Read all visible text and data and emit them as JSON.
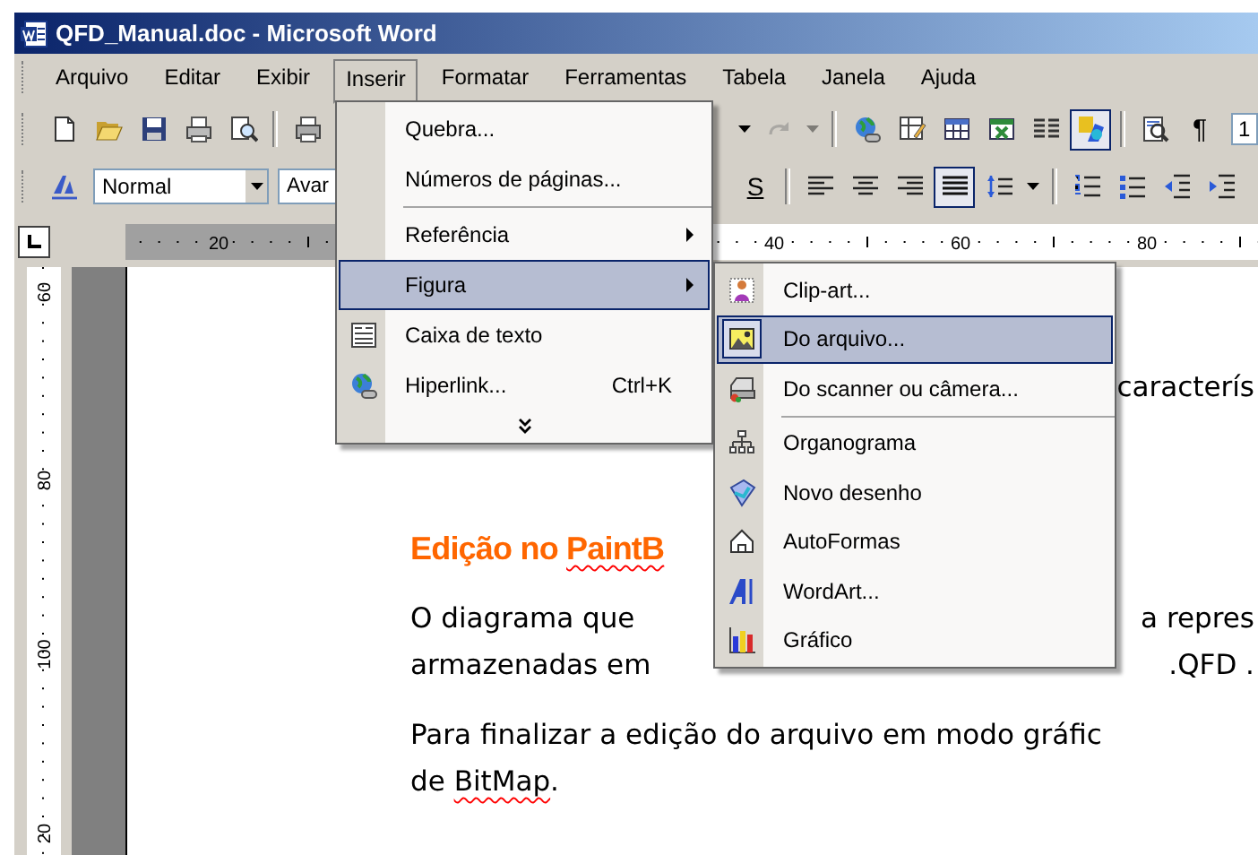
{
  "window": {
    "title": "QFD_Manual.doc - Microsoft Word"
  },
  "menu_bar": [
    {
      "label": "Arquivo",
      "selected": false
    },
    {
      "label": "Editar",
      "selected": false
    },
    {
      "label": "Exibir",
      "selected": false
    },
    {
      "label": "Inserir",
      "selected": true
    },
    {
      "label": "Formatar",
      "selected": false
    },
    {
      "label": "Ferramentas",
      "selected": false
    },
    {
      "label": "Tabela",
      "selected": false
    },
    {
      "label": "Janela",
      "selected": false
    },
    {
      "label": "Ajuda",
      "selected": false
    }
  ],
  "toolbars": {
    "standard": {
      "left": [
        {
          "kind": "button",
          "pressed": false,
          "disabled": false
        },
        {
          "kind": "button",
          "pressed": false,
          "disabled": false
        },
        {
          "kind": "button",
          "pressed": false,
          "disabled": false
        },
        {
          "kind": "button",
          "pressed": false,
          "disabled": false
        },
        {
          "kind": "button",
          "pressed": false,
          "disabled": false
        },
        {
          "kind": "separator"
        },
        {
          "kind": "button",
          "pressed": false,
          "disabled": false
        }
      ],
      "right": [
        {
          "kind": "arrow",
          "disabled": false
        },
        {
          "kind": "button",
          "pressed": false,
          "disabled": true
        },
        {
          "kind": "arrow",
          "disabled": true
        },
        {
          "kind": "separator"
        },
        {
          "kind": "button",
          "pressed": false,
          "disabled": false
        },
        {
          "kind": "button",
          "pressed": false,
          "disabled": false
        },
        {
          "kind": "button",
          "pressed": false,
          "disabled": false
        },
        {
          "kind": "button",
          "pressed": false,
          "disabled": false
        },
        {
          "kind": "button",
          "pressed": false,
          "disabled": false
        },
        {
          "kind": "button",
          "pressed": true,
          "disabled": false
        },
        {
          "kind": "separator"
        },
        {
          "kind": "button",
          "pressed": false,
          "disabled": false
        },
        {
          "kind": "text_button",
          "label": "¶",
          "pressed": false,
          "disabled": false
        },
        {
          "kind": "field",
          "value": "1"
        }
      ]
    },
    "formatting": {
      "left": [
        {
          "kind": "button",
          "pressed": false,
          "disabled": false
        },
        {
          "kind": "combo",
          "value": "Normal"
        },
        {
          "kind": "combo",
          "value": "Avar"
        }
      ],
      "right": [
        {
          "kind": "text_button",
          "label": "S",
          "pressed": false,
          "disabled": false
        },
        {
          "kind": "separator"
        },
        {
          "kind": "button",
          "pressed": false,
          "disabled": false
        },
        {
          "kind": "button",
          "pressed": false,
          "disabled": false
        },
        {
          "kind": "button",
          "pressed": false,
          "disabled": false
        },
        {
          "kind": "button",
          "pressed": true,
          "disabled": false
        },
        {
          "kind": "button",
          "pressed": false,
          "disabled": false
        },
        {
          "kind": "arrow",
          "disabled": false
        },
        {
          "kind": "separator"
        },
        {
          "kind": "button",
          "pressed": false,
          "disabled": false
        },
        {
          "kind": "button",
          "pressed": false,
          "disabled": false
        },
        {
          "kind": "button",
          "pressed": false,
          "disabled": false
        },
        {
          "kind": "button",
          "pressed": false,
          "disabled": false
        }
      ]
    }
  },
  "ruler": {
    "labels": [
      "20",
      "40",
      "60",
      "80"
    ]
  },
  "vertical_ruler": {
    "labels": [
      "60",
      "80",
      "100",
      "20"
    ]
  },
  "document": {
    "blocks": [
      {
        "kind": "paragraph",
        "lines": [
          {
            "right": [
              {
                "text": "caracterís",
                "misspelled": false
              }
            ]
          }
        ]
      },
      {
        "kind": "heading",
        "lines": [
          {
            "left": [
              {
                "text": "Edição no ",
                "misspelled": false
              },
              {
                "text": "PaintB",
                "misspelled": true
              }
            ]
          }
        ]
      },
      {
        "kind": "paragraph",
        "lines": [
          {
            "left": [
              {
                "text": "O diagrama que",
                "misspelled": false
              }
            ],
            "right": [
              {
                "text": "a repres",
                "misspelled": false
              }
            ]
          },
          {
            "left": [
              {
                "text": "armazenadas em",
                "misspelled": false
              }
            ],
            "right": [
              {
                "text": ".QFD .",
                "misspelled": false
              }
            ]
          }
        ]
      },
      {
        "kind": "paragraph",
        "lines": [
          {
            "left": [
              {
                "text": "Para finalizar a edição do arquivo em modo gráfic",
                "misspelled": false
              }
            ]
          },
          {
            "left": [
              {
                "text": "de ",
                "misspelled": false
              },
              {
                "text": "BitMap",
                "misspelled": true
              },
              {
                "text": ".",
                "misspelled": false
              }
            ]
          }
        ]
      }
    ]
  },
  "open_menu": {
    "items": [
      {
        "kind": "item",
        "label": "Quebra...",
        "selected": false,
        "arrow": false
      },
      {
        "kind": "item",
        "label": "Números de páginas...",
        "selected": false,
        "arrow": false
      },
      {
        "kind": "separator"
      },
      {
        "kind": "item",
        "label": "Referência",
        "selected": false,
        "arrow": true
      },
      {
        "kind": "item",
        "label": "Figura",
        "selected": true,
        "arrow": true,
        "submenu": {
          "items": [
            {
              "kind": "item",
              "label": "Clip-art...",
              "selected": false,
              "arrow": false
            },
            {
              "kind": "item",
              "label": "Do arquivo...",
              "selected": true,
              "arrow": false
            },
            {
              "kind": "item",
              "label": "Do scanner ou câmera...",
              "selected": false,
              "arrow": false
            },
            {
              "kind": "separator"
            },
            {
              "kind": "item",
              "label": "Organograma",
              "selected": false,
              "arrow": false
            },
            {
              "kind": "item",
              "label": "Novo desenho",
              "selected": false,
              "arrow": false
            },
            {
              "kind": "item",
              "label": "AutoFormas",
              "selected": false,
              "arrow": false
            },
            {
              "kind": "item",
              "label": "WordArt...",
              "selected": false,
              "arrow": false
            },
            {
              "kind": "item",
              "label": "Gráfico",
              "selected": false,
              "arrow": false
            }
          ]
        }
      },
      {
        "kind": "item",
        "label": "Caixa de texto",
        "selected": false,
        "arrow": false
      },
      {
        "kind": "item",
        "label": "Hiperlink...",
        "shortcut": "Ctrl+K",
        "selected": false,
        "arrow": false
      },
      {
        "kind": "expand"
      }
    ]
  }
}
